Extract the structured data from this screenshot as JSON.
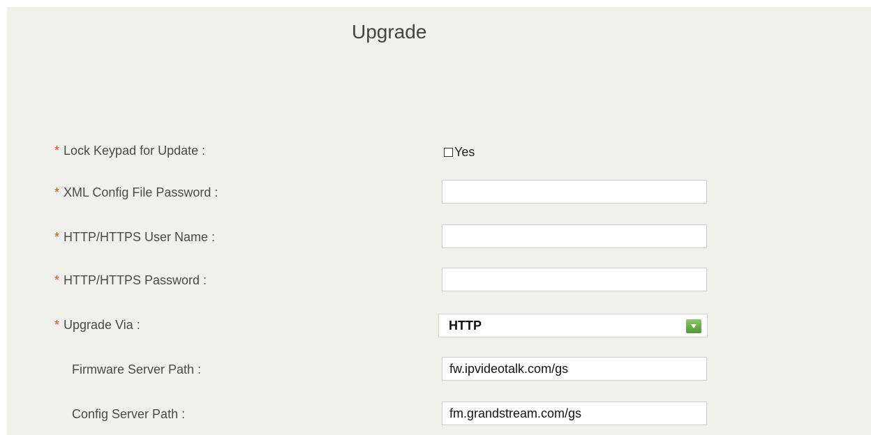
{
  "page": {
    "title": "Upgrade"
  },
  "form": {
    "required_marker": "*",
    "lock_keypad": {
      "label": "Lock Keypad for Update :",
      "checkbox_label": "Yes",
      "checked": false
    },
    "xml_config_password": {
      "label": "XML Config File Password :",
      "value": ""
    },
    "http_user_name": {
      "label": "HTTP/HTTPS User Name :",
      "value": ""
    },
    "http_password": {
      "label": "HTTP/HTTPS Password :",
      "value": ""
    },
    "upgrade_via": {
      "label": "Upgrade Via :",
      "selected": "HTTP"
    },
    "firmware_server_path": {
      "label": "Firmware Server Path :",
      "value": "fw.ipvideotalk.com/gs"
    },
    "config_server_path": {
      "label": "Config Server Path :",
      "value": "fm.grandstream.com/gs"
    }
  },
  "colors": {
    "panel_background": "#f1f1ec",
    "required_asterisk": "#e84a1a",
    "dropdown_arrow": "#5fa83f"
  },
  "icons": {
    "dropdown": "chevron-down-icon"
  }
}
